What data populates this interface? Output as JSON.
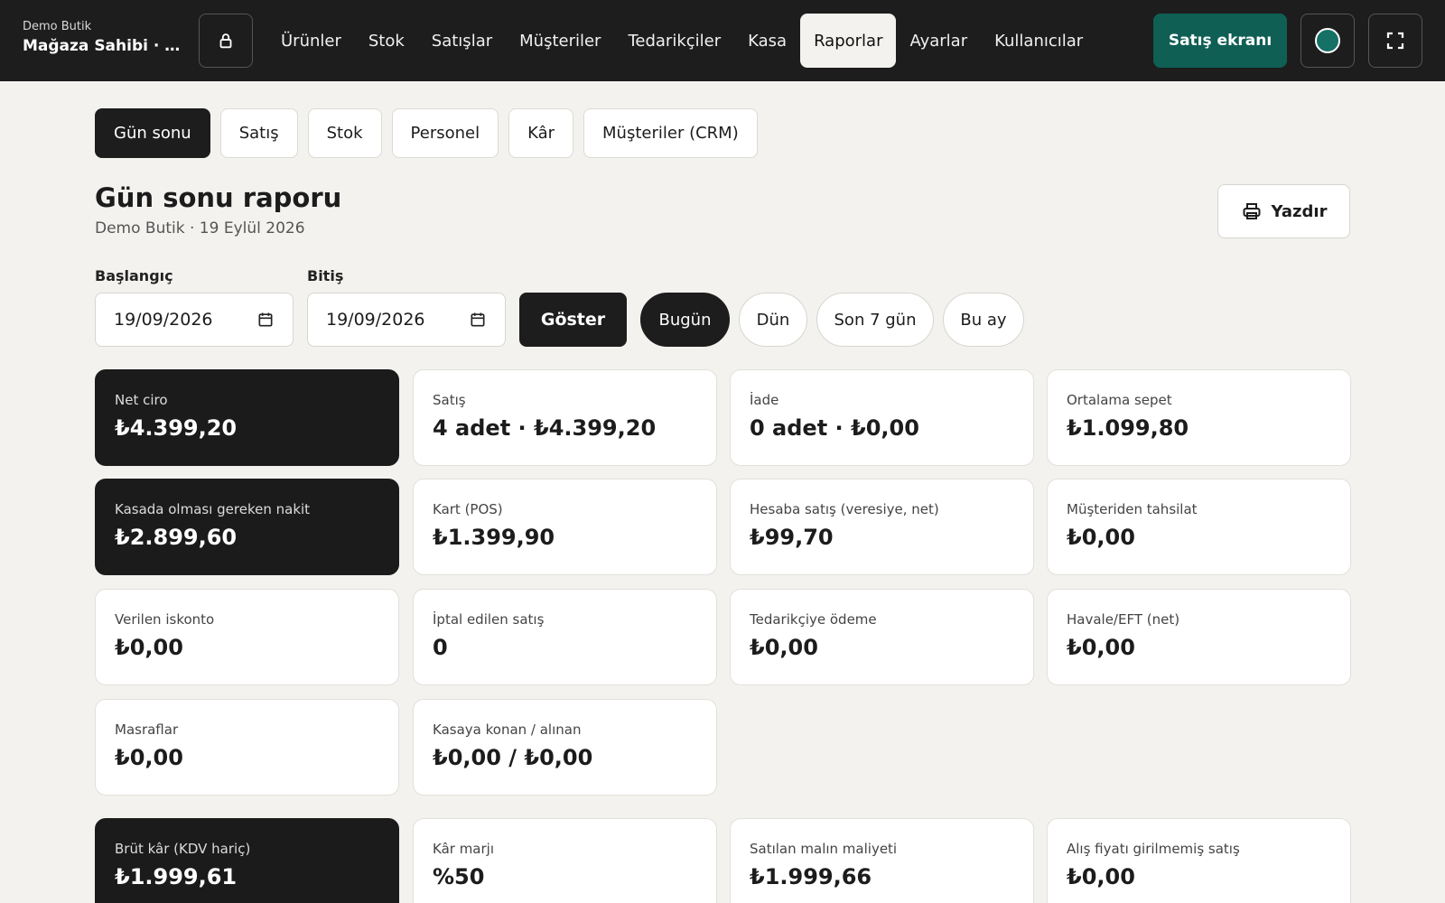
{
  "header": {
    "store_name": "Demo Butik",
    "user_label": "Mağaza Sahibi · S...",
    "nav": [
      "Ürünler",
      "Stok",
      "Satışlar",
      "Müşteriler",
      "Tedarikçiler",
      "Kasa",
      "Raporlar",
      "Ayarlar",
      "Kullanıcılar"
    ],
    "active_nav": "Raporlar",
    "pos_button": "Satış ekranı",
    "accent_color": "#0f5f55"
  },
  "report_tabs": [
    "Gün sonu",
    "Satış",
    "Stok",
    "Personel",
    "Kâr",
    "Müşteriler (CRM)"
  ],
  "page": {
    "title": "Gün sonu raporu",
    "subtitle": "Demo Butik · 19 Eylül 2026",
    "print_button": "Yazdır"
  },
  "filters": {
    "start_label": "Başlangıç",
    "start_value": "19/09/2026",
    "end_label": "Bitiş",
    "end_value": "19/09/2026",
    "show_button": "Göster",
    "quick_ranges": [
      "Bugün",
      "Dün",
      "Son 7 gün",
      "Bu ay"
    ],
    "active_range": "Bugün"
  },
  "cards": [
    {
      "label": "Net ciro",
      "value": "₺4.399,20",
      "dark": true
    },
    {
      "label": "Satış",
      "value": "4 adet · ₺4.399,20",
      "dark": false
    },
    {
      "label": "İade",
      "value": "0 adet · ₺0,00",
      "dark": false
    },
    {
      "label": "Ortalama sepet",
      "value": "₺1.099,80",
      "dark": false
    },
    {
      "label": "Kasada olması gereken nakit",
      "value": "₺2.899,60",
      "dark": true
    },
    {
      "label": "Kart (POS)",
      "value": "₺1.399,90",
      "dark": false
    },
    {
      "label": "Hesaba satış (veresiye, net)",
      "value": "₺99,70",
      "dark": false
    },
    {
      "label": "Müşteriden tahsilat",
      "value": "₺0,00",
      "dark": false
    },
    {
      "label": "Verilen iskonto",
      "value": "₺0,00",
      "dark": false
    },
    {
      "label": "İptal edilen satış",
      "value": "0",
      "dark": false
    },
    {
      "label": "Tedarikçiye ödeme",
      "value": "₺0,00",
      "dark": false
    },
    {
      "label": "Havale/EFT (net)",
      "value": "₺0,00",
      "dark": false
    },
    {
      "label": "Masraflar",
      "value": "₺0,00",
      "dark": false
    },
    {
      "label": "Kasaya konan / alınan",
      "value": "₺0,00 / ₺0,00",
      "dark": false
    },
    {
      "label": "Brüt kâr (KDV hariç)",
      "value": "₺1.999,61",
      "dark": true
    },
    {
      "label": "Kâr marjı",
      "value": "%50",
      "dark": false
    },
    {
      "label": "Satılan malın maliyeti",
      "value": "₺1.999,66",
      "dark": false
    },
    {
      "label": "Alış fiyatı girilmemiş satış",
      "value": "₺0,00",
      "dark": false
    }
  ]
}
